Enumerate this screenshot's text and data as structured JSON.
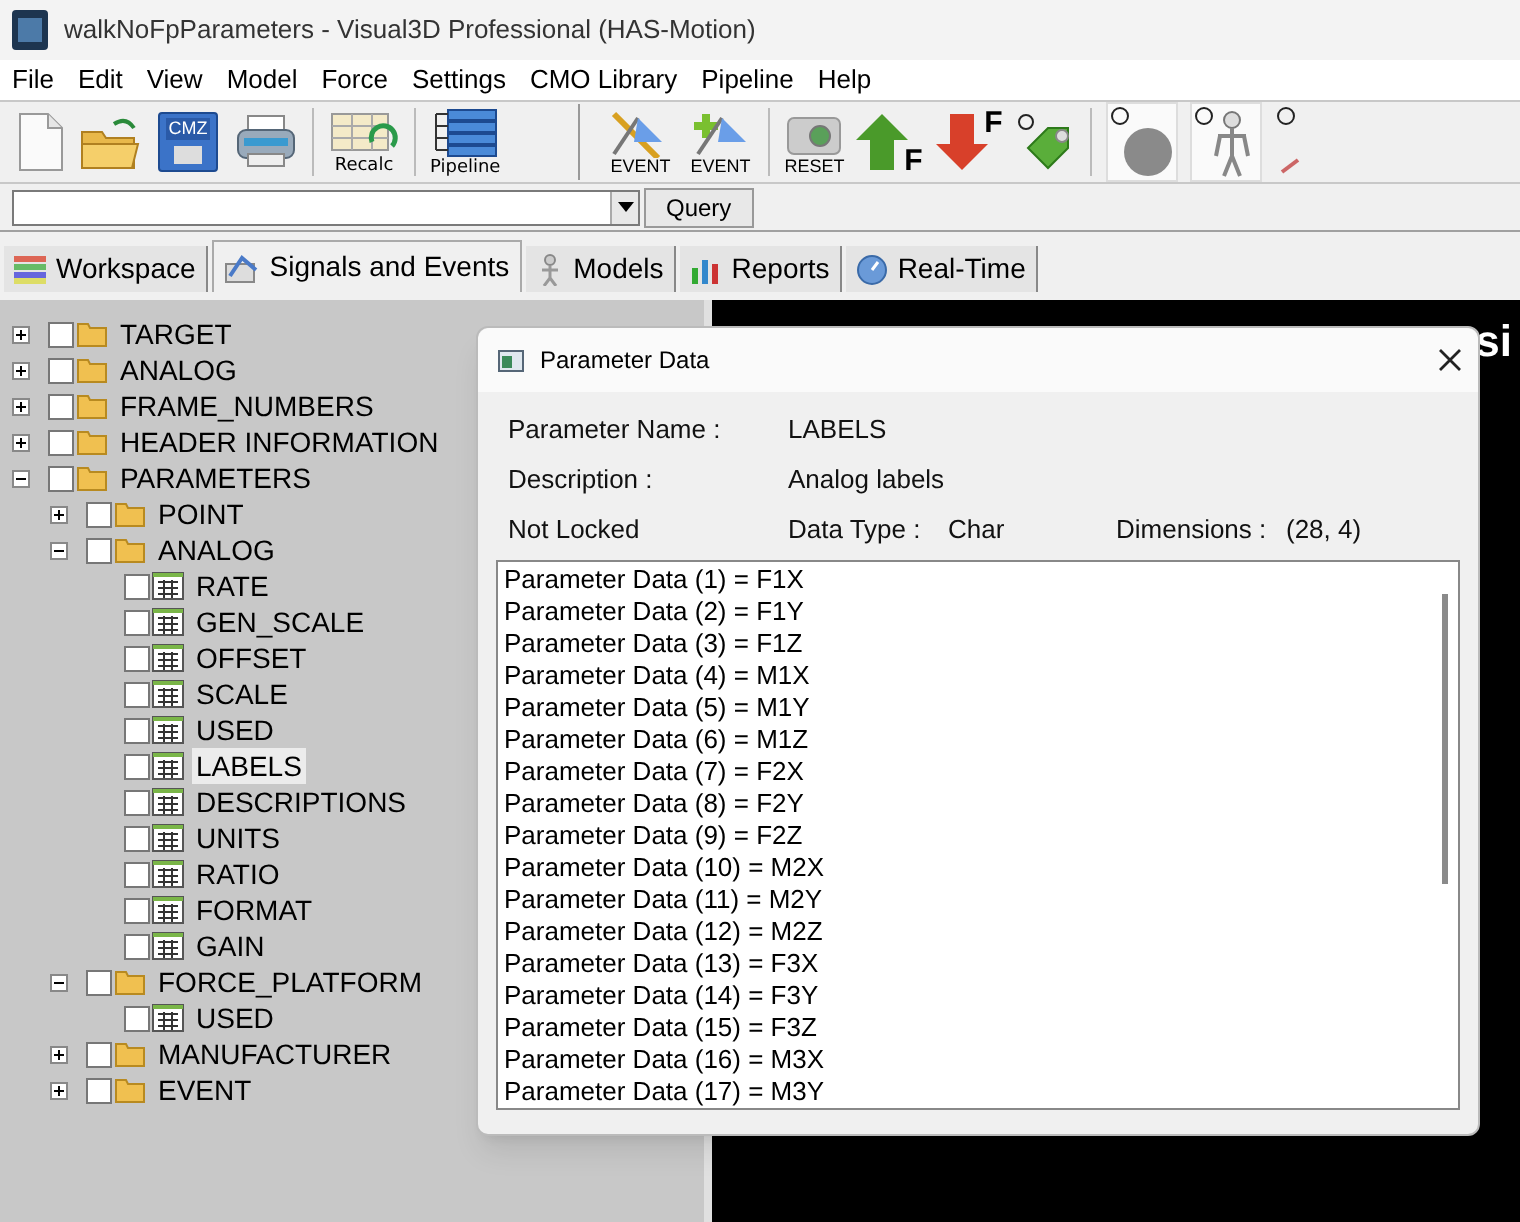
{
  "window": {
    "title": "walkNoFpParameters - Visual3D Professional (HAS-Motion)"
  },
  "menu": [
    "File",
    "Edit",
    "View",
    "Model",
    "Force",
    "Settings",
    "CMO Library",
    "Pipeline",
    "Help"
  ],
  "toolbar": [
    {
      "kind": "new"
    },
    {
      "kind": "open"
    },
    {
      "kind": "save",
      "label": "CMZ"
    },
    {
      "kind": "print"
    },
    {
      "kind": "sep"
    },
    {
      "kind": "recalc",
      "label": "Recalc"
    },
    {
      "kind": "sep"
    },
    {
      "kind": "pipeline",
      "label": "Pipeline"
    },
    {
      "kind": "gap"
    },
    {
      "kind": "event_edit",
      "label": "EVENT"
    },
    {
      "kind": "event_add",
      "label": "EVENT"
    },
    {
      "kind": "sep"
    },
    {
      "kind": "reset",
      "label": "RESET"
    },
    {
      "kind": "force_up",
      "label": "F"
    },
    {
      "kind": "force_down",
      "label": "F"
    },
    {
      "kind": "tag"
    },
    {
      "kind": "sep"
    },
    {
      "kind": "ball"
    },
    {
      "kind": "skeleton"
    },
    {
      "kind": "partial"
    }
  ],
  "query": {
    "button": "Query"
  },
  "tabs": [
    {
      "label": "Workspace",
      "kind": "workspace",
      "selected": false
    },
    {
      "label": "Signals and Events",
      "kind": "signals",
      "selected": true
    },
    {
      "label": "Models",
      "kind": "models",
      "selected": false
    },
    {
      "label": "Reports",
      "kind": "reports",
      "selected": false
    },
    {
      "label": "Real-Time",
      "kind": "realtime",
      "selected": false
    }
  ],
  "tree": [
    {
      "label": "TARGET",
      "kind": "folder",
      "expanded": false,
      "checked": false,
      "selected": false
    },
    {
      "label": "ANALOG",
      "kind": "folder",
      "expanded": false,
      "checked": false,
      "selected": false
    },
    {
      "label": "FRAME_NUMBERS",
      "kind": "folder",
      "expanded": false,
      "checked": false,
      "selected": false
    },
    {
      "label": "HEADER INFORMATION",
      "kind": "folder",
      "expanded": false,
      "checked": false,
      "selected": false
    },
    {
      "label": "PARAMETERS",
      "kind": "folder",
      "expanded": true,
      "checked": false,
      "selected": false,
      "children": [
        {
          "label": "POINT",
          "kind": "folder",
          "expanded": false,
          "checked": false,
          "selected": false
        },
        {
          "label": "ANALOG",
          "kind": "folder",
          "expanded": true,
          "checked": false,
          "selected": false,
          "children": [
            {
              "label": "RATE",
              "kind": "parameter",
              "checked": false,
              "selected": false
            },
            {
              "label": "GEN_SCALE",
              "kind": "parameter",
              "checked": false,
              "selected": false
            },
            {
              "label": "OFFSET",
              "kind": "parameter",
              "checked": false,
              "selected": false
            },
            {
              "label": "SCALE",
              "kind": "parameter",
              "checked": false,
              "selected": false
            },
            {
              "label": "USED",
              "kind": "parameter",
              "checked": false,
              "selected": false
            },
            {
              "label": "LABELS",
              "kind": "parameter",
              "checked": false,
              "selected": true
            },
            {
              "label": "DESCRIPTIONS",
              "kind": "parameter",
              "checked": false,
              "selected": false
            },
            {
              "label": "UNITS",
              "kind": "parameter",
              "checked": false,
              "selected": false
            },
            {
              "label": "RATIO",
              "kind": "parameter",
              "checked": false,
              "selected": false
            },
            {
              "label": "FORMAT",
              "kind": "parameter",
              "checked": false,
              "selected": false
            },
            {
              "label": "GAIN",
              "kind": "parameter",
              "checked": false,
              "selected": false
            }
          ]
        },
        {
          "label": "FORCE_PLATFORM",
          "kind": "folder",
          "expanded": true,
          "checked": false,
          "selected": false,
          "children": [
            {
              "label": "USED",
              "kind": "parameter",
              "checked": false,
              "selected": false
            }
          ]
        },
        {
          "label": "MANUFACTURER",
          "kind": "folder",
          "expanded": false,
          "checked": false,
          "selected": false
        },
        {
          "label": "EVENT",
          "kind": "folder",
          "expanded": false,
          "checked": false,
          "selected": false
        }
      ]
    }
  ],
  "canvas": {
    "text": "si"
  },
  "dialog": {
    "title": "Parameter Data",
    "parameter_name": {
      "label": "Parameter Name :",
      "value": "LABELS"
    },
    "description": {
      "label": "Description :",
      "value": "Analog labels"
    },
    "lock_status": "Not Locked",
    "data_type": {
      "label": "Data Type :",
      "value": "Char"
    },
    "dimensions": {
      "label": "Dimensions :",
      "value": "(28, 4)"
    },
    "lines": [
      "Parameter Data (1) = F1X",
      "Parameter Data (2) = F1Y",
      "Parameter Data (3) = F1Z",
      "Parameter Data (4) = M1X",
      "Parameter Data (5) = M1Y",
      "Parameter Data (6) = M1Z",
      "Parameter Data (7) = F2X",
      "Parameter Data (8) = F2Y",
      "Parameter Data (9) = F2Z",
      "Parameter Data (10) = M2X",
      "Parameter Data (11) = M2Y",
      "Parameter Data (12) = M2Z",
      "Parameter Data (13) = F3X",
      "Parameter Data (14) = F3Y",
      "Parameter Data (15) = F3Z",
      "Parameter Data (16) = M3X",
      "Parameter Data (17) = M3Y"
    ]
  }
}
